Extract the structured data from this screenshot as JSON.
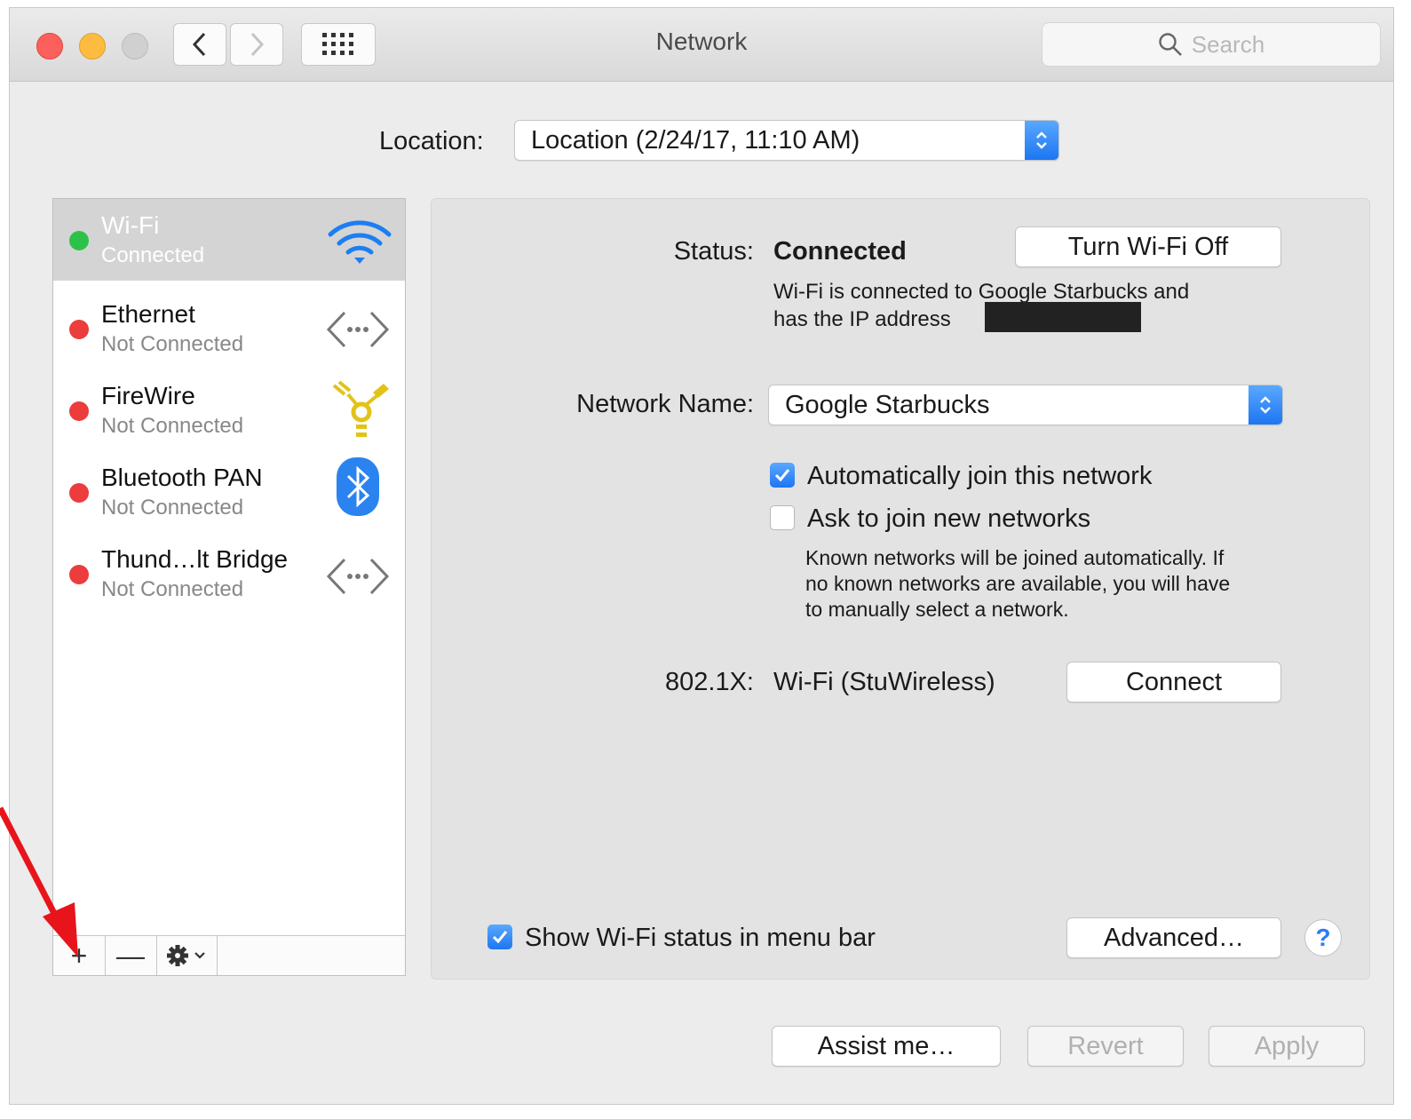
{
  "window": {
    "title": "Network",
    "search_placeholder": "Search"
  },
  "location": {
    "label": "Location:",
    "value": "Location (2/24/17, 11:10 AM)"
  },
  "services": [
    {
      "name": "Wi-Fi",
      "status": "Connected",
      "status_color": "#2cc24a",
      "icon": "wifi-icon",
      "selected": true
    },
    {
      "name": "Ethernet",
      "status": "Not Connected",
      "status_color": "#ec3c3c",
      "icon": "ethernet-icon"
    },
    {
      "name": "FireWire",
      "status": "Not Connected",
      "status_color": "#ec3c3c",
      "icon": "firewire-icon"
    },
    {
      "name": "Bluetooth PAN",
      "status": "Not Connected",
      "status_color": "#ec3c3c",
      "icon": "bluetooth-icon"
    },
    {
      "name": "Thund…lt Bridge",
      "status": "Not Connected",
      "status_color": "#ec3c3c",
      "icon": "thunderbolt-bridge-icon"
    }
  ],
  "sidebar_toolbar": {
    "add": "+",
    "remove": "—",
    "action_icon": "gear-icon"
  },
  "detail": {
    "status_label": "Status:",
    "status_value": "Connected",
    "turn_off_button": "Turn Wi-Fi Off",
    "status_desc_line1": "Wi-Fi is connected to Google Starbucks and",
    "status_desc_line2": "has the IP address",
    "network_name_label": "Network Name:",
    "network_name_value": "Google Starbucks",
    "auto_join_label": "Automatically join this network",
    "auto_join_checked": true,
    "ask_join_label": "Ask to join new networks",
    "ask_join_checked": false,
    "known_note_line1": "Known networks will be joined automatically. If",
    "known_note_line2": "no known networks are available, you will have",
    "known_note_line3": "to manually select a network.",
    "dot1x_label": "802.1X:",
    "dot1x_value": "Wi-Fi (StuWireless)",
    "connect_button": "Connect",
    "show_status_label": "Show Wi-Fi status in menu bar",
    "show_status_checked": true,
    "advanced_button": "Advanced…",
    "help": "?"
  },
  "footer": {
    "assist_button": "Assist me…",
    "revert_button": "Revert",
    "apply_button": "Apply"
  },
  "colors": {
    "accent": "#1d76f2",
    "connected": "#2cc24a",
    "not_connected": "#ec3c3c",
    "annotation_arrow": "#e8141c"
  }
}
